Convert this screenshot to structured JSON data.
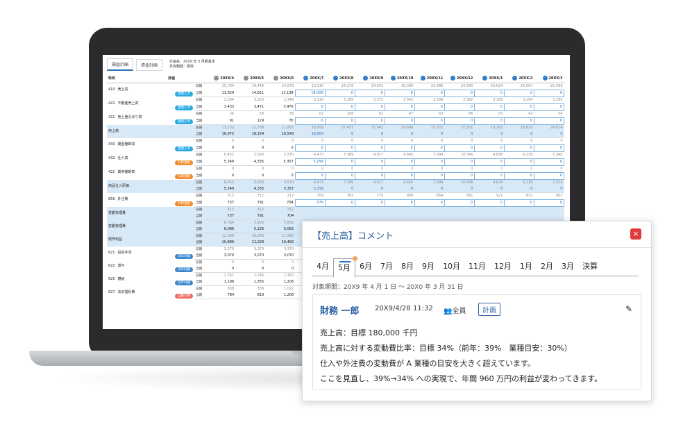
{
  "screen": {
    "tabs": [
      {
        "label": "損益計画",
        "active": true
      },
      {
        "label": "資金計画",
        "active": false
      }
    ],
    "plan_name_label": "計画名",
    "plan_name_value": "：2020 年 3 月期基本",
    "share_label": "共有範囲：",
    "share_value": "関係",
    "header": {
      "item_col": "科目",
      "plan_col": "計画",
      "months": [
        "20XX/4",
        "20XX/5",
        "20XX/6",
        "20XX/7",
        "20XX/8",
        "20XX/9",
        "20XX/10",
        "20XX/11",
        "20XX/12",
        "20XX/1",
        "20XX/2",
        "20XX/3"
      ],
      "actual_months": 3
    },
    "rows": [
      {
        "code": "410",
        "name": "売上高",
        "badge": "直接入力",
        "badge_color": "blue",
        "sum": false,
        "prev": [
          "15,784",
          "19,446",
          "14,575",
          "13,310",
          "24,276",
          "14,632",
          "16,389",
          "22,486",
          "24,595",
          "16,024",
          "15,567",
          "21,569"
        ],
        "cur": [
          "13,629",
          "14,811",
          "13,138",
          "18,000",
          "0",
          "0",
          "0",
          "0",
          "0",
          "0",
          "0",
          "0"
        ]
      },
      {
        "code": "422",
        "name": "不動産売上高",
        "badge": "直接入力",
        "badge_color": "blue",
        "sum": false,
        "prev": [
          "3,384",
          "3,320",
          "3,348",
          "3,310",
          "3,289",
          "3,373",
          "3,343",
          "3,299",
          "3,392",
          "3,326",
          "3,294",
          "3,299"
        ],
        "cur": [
          "3,433",
          "3,471",
          "3,476",
          "0",
          "0",
          "0",
          "0",
          "0",
          "0",
          "0",
          "0",
          "0"
        ]
      },
      {
        "code": "421",
        "name": "売上値引戻り高",
        "badge": "直接入力",
        "badge_color": "blue",
        "sum": false,
        "prev": [
          "36",
          "58",
          "56",
          "62",
          "108",
          "62",
          "47",
          "63",
          "86",
          "83",
          "42",
          "54"
        ],
        "cur": [
          "91",
          "129",
          "70",
          "0",
          "0",
          "0",
          "0",
          "0",
          "0",
          "0",
          "0",
          "0"
        ]
      },
      {
        "code": "",
        "name": "売上高",
        "badge": "",
        "badge_color": "",
        "sum": true,
        "prev": [
          "13,133",
          "22,708",
          "17,867",
          "16,559",
          "27,457",
          "17,942",
          "19,686",
          "25,722",
          "27,501",
          "19,265",
          "18,820",
          "24,814"
        ],
        "cur": [
          "16,972",
          "18,154",
          "16,543",
          "18,000",
          "0",
          "0",
          "0",
          "0",
          "0",
          "0",
          "0",
          "0"
        ]
      },
      {
        "code": "430",
        "name": "期首棚卸高",
        "badge": "直接入力",
        "badge_color": "blue",
        "sum": false,
        "prev": [
          "0",
          "0",
          "0",
          "0",
          "0",
          "0",
          "0",
          "0",
          "0",
          "0",
          "0",
          "0"
        ],
        "cur": [
          "0",
          "0",
          "0",
          "0",
          "0",
          "0",
          "0",
          "0",
          "0",
          "0",
          "0",
          "0"
        ]
      },
      {
        "code": "432",
        "name": "仕入高",
        "badge": "科目連動",
        "badge_color": "orange",
        "sum": false,
        "prev": [
          "6,452",
          "5,590",
          "5,570",
          "4,473",
          "7,389",
          "4,917",
          "4,645",
          "7,099",
          "10,546",
          "4,826",
          "6,239",
          "7,340"
        ],
        "cur": [
          "5,349",
          "4,335",
          "5,357",
          "5,256",
          "0",
          "0",
          "0",
          "0",
          "0",
          "0",
          "0",
          "0"
        ]
      },
      {
        "code": "422",
        "name": "期末棚卸高",
        "badge": "科目連動",
        "badge_color": "orange",
        "sum": false,
        "prev": [
          "0",
          "0",
          "0",
          "0",
          "0",
          "0",
          "0",
          "0",
          "0",
          "0",
          "0",
          "0"
        ],
        "cur": [
          "0",
          "0",
          "0",
          "0",
          "0",
          "0",
          "0",
          "0",
          "0",
          "0",
          "0",
          "0"
        ]
      },
      {
        "code": "",
        "name": "商品仕入原価",
        "badge": "",
        "badge_color": "",
        "sum": true,
        "prev": [
          "6,452",
          "5,590",
          "5,570",
          "4,473",
          "7,389",
          "4,917",
          "4,645",
          "7,099",
          "10,546",
          "4,826",
          "6,239",
          "7,324"
        ],
        "cur": [
          "5,349",
          "4,335",
          "5,357",
          "5,256",
          "0",
          "0",
          "0",
          "0",
          "0",
          "0",
          "0",
          "0"
        ]
      },
      {
        "code": "656",
        "name": "外注費",
        "badge": "科目連動",
        "badge_color": "orange",
        "sum": false,
        "prev": [
          "312",
          "312",
          "312",
          "359",
          "781",
          "779",
          "989",
          "864",
          "881",
          "921",
          "821",
          "803"
        ],
        "cur": [
          "737",
          "791",
          "704",
          "576",
          "0",
          "0",
          "0",
          "0",
          "0",
          "0",
          "0",
          "0"
        ]
      },
      {
        "code": "",
        "name": "変動管理費",
        "badge": "",
        "badge_color": "",
        "sum": true,
        "prev": [
          "312",
          "312",
          "312",
          "",
          "",
          "",
          "",
          "",
          "",
          "",
          "",
          ""
        ],
        "cur": [
          "737",
          "791",
          "704",
          "",
          "",
          "",
          "",
          "",
          "",
          "",
          "",
          ""
        ]
      },
      {
        "code": "",
        "name": "変動管理費",
        "badge": "",
        "badge_color": "",
        "sum": true,
        "prev": [
          "6,764",
          "5,902",
          "5,882",
          "",
          "",
          "",
          "",
          "",
          "",
          "",
          "",
          ""
        ],
        "cur": [
          "6,086",
          "5,126",
          "6,062",
          "",
          "",
          "",
          "",
          "",
          "",
          "",
          "",
          ""
        ]
      },
      {
        "code": "",
        "name": "限界利益",
        "badge": "",
        "badge_color": "",
        "sum": true,
        "prev": [
          "12,369",
          "16,806",
          "11,985",
          "",
          "",
          "",
          "",
          "",
          "",
          "",
          "",
          ""
        ],
        "cur": [
          "10,886",
          "12,028",
          "10,482",
          "",
          "",
          "",
          "",
          "",
          "",
          "",
          "",
          ""
        ]
      },
      {
        "code": "621",
        "name": "役員手当",
        "badge": "前年同額",
        "badge_color": "darkblue",
        "sum": false,
        "prev": [
          "3,370",
          "3,370",
          "3,370",
          "",
          "",
          "",
          "",
          "",
          "",
          "",
          "",
          ""
        ],
        "cur": [
          "3,070",
          "3,070",
          "3,070",
          "",
          "",
          "",
          "",
          "",
          "",
          "",
          "",
          ""
        ]
      },
      {
        "code": "622",
        "name": "賞与",
        "badge": "前年同額",
        "badge_color": "darkblue",
        "sum": false,
        "prev": [
          "0",
          "0",
          "0",
          "",
          "",
          "",
          "",
          "",
          "",
          "",
          "",
          ""
        ],
        "cur": [
          "0",
          "0",
          "0",
          "",
          "",
          "",
          "",
          "",
          "",
          "",
          "",
          ""
        ]
      },
      {
        "code": "625",
        "name": "雑給",
        "badge": "前年同額",
        "badge_color": "darkblue",
        "sum": false,
        "prev": [
          "1,761",
          "1,746",
          "1,360",
          "",
          "",
          "",
          "",
          "",
          "",
          "",
          "",
          ""
        ],
        "cur": [
          "1,199",
          "1,355",
          "1,206",
          "",
          "",
          "",
          "",
          "",
          "",
          "",
          "",
          ""
        ]
      },
      {
        "code": "627",
        "name": "法定福利費",
        "badge": "自動計算",
        "badge_color": "red",
        "sum": false,
        "prev": [
          "838",
          "838",
          "1,022",
          "",
          "",
          "",
          "",
          "",
          "",
          "",
          "",
          ""
        ],
        "cur": [
          "784",
          "819",
          "1,206",
          "",
          "",
          "",
          "",
          "",
          "",
          "",
          "",
          ""
        ]
      }
    ],
    "prev_label": "前期",
    "cur_label": "当期"
  },
  "popup": {
    "title": "【売上高】コメント",
    "close_icon": "×",
    "months": [
      "4月",
      "5月",
      "6月",
      "7月",
      "8月",
      "9月",
      "10月",
      "11月",
      "12月",
      "1月",
      "2月",
      "3月",
      "決算"
    ],
    "active_month": "5月",
    "period": "対象期間：20X9 年 4 月 1 日 ～ 20X0 年 3 月 31 日",
    "comment": {
      "author": "財務 一郎",
      "datetime": "20X9/4/28 11:32",
      "scope": "全員",
      "tag": "計画",
      "lines": [
        "売上高：目標 180,000 千円",
        "売上高に対する変動費比率：目標 34%（前年：39%　業種目安：30%）",
        "仕入や外注費の変動費が A 業種の目安を大きく超えています。",
        "ここを見直し、39%→34% への実現で、年間 960 万円の利益が変わってきます。"
      ]
    }
  }
}
